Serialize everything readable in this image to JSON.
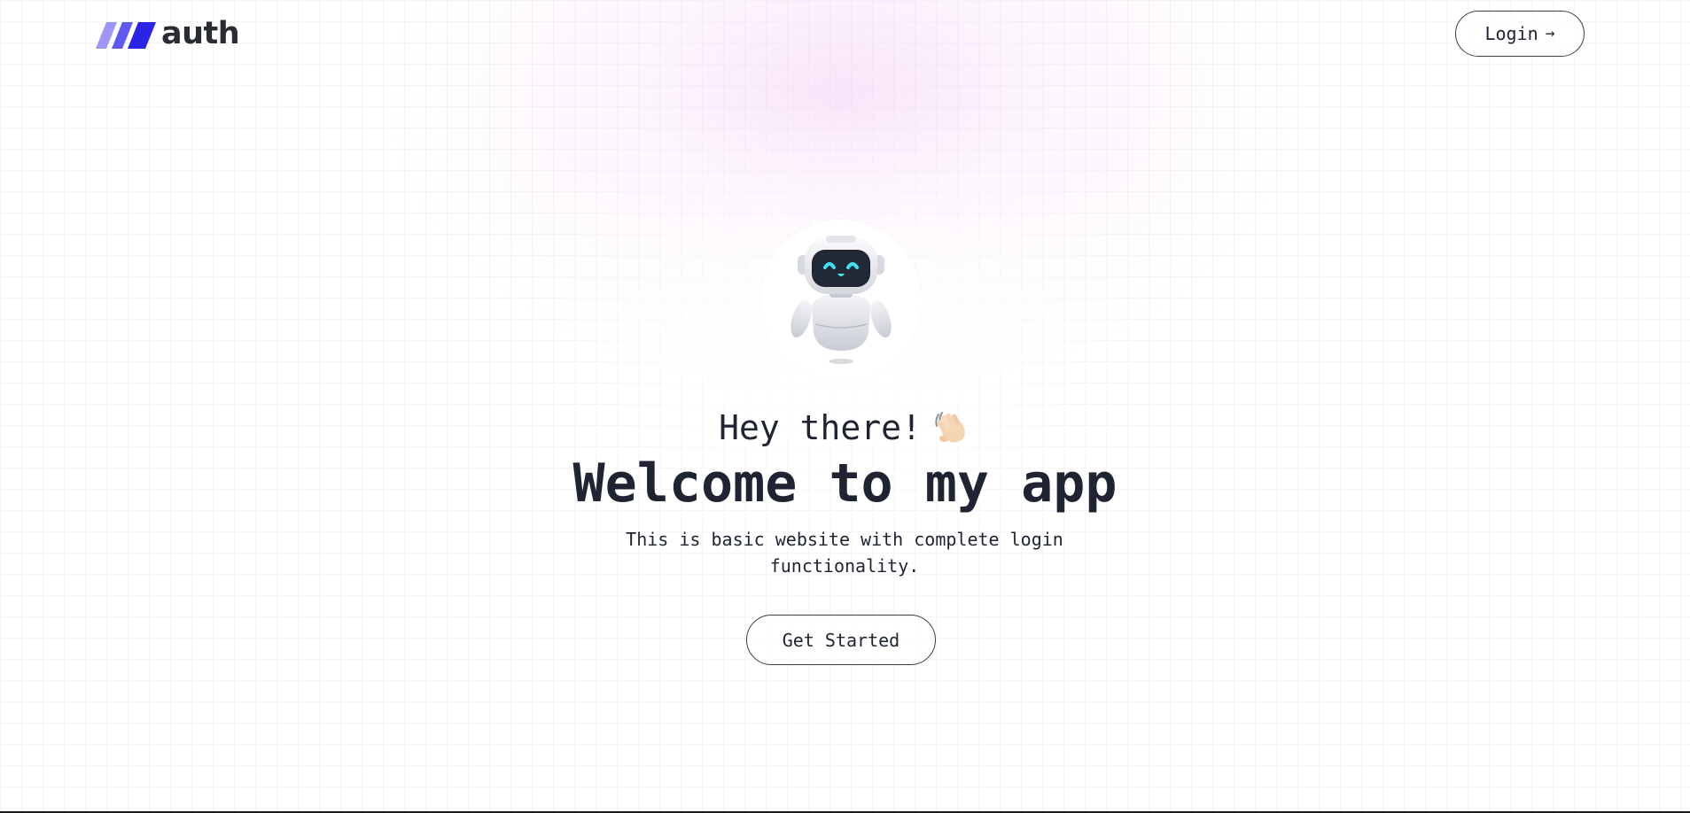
{
  "header": {
    "logo_text": "auth",
    "login_label": "Login",
    "login_arrow": "→"
  },
  "hero": {
    "greeting": "Hey there!",
    "title": "Welcome to my app",
    "subtitle": "This is basic website with complete login functionality.",
    "cta_label": "Get Started"
  },
  "icons": {
    "logo": "logo-stripes-icon",
    "login_arrow": "arrow-right-icon",
    "avatar": "robot-icon",
    "greeting": "waving-hand-icon"
  },
  "colors": {
    "text": "#1f2433",
    "logo_light": "#8b87f5",
    "logo_mid": "#5b54f0",
    "logo_dark": "#2b23e8",
    "glow": "#f4cdf5",
    "robot_eyes": "#3fe3f0"
  }
}
